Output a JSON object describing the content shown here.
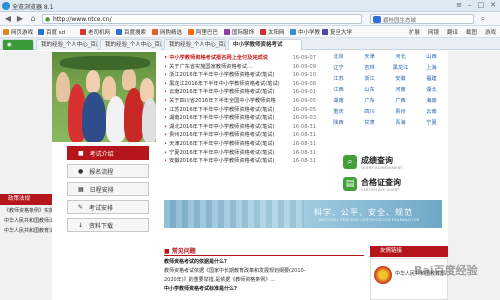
{
  "browser": {
    "title": "全览浏览器 8.1",
    "url": "http://www.ntce.cn/",
    "search_text": "碧桂园生态城",
    "favorites": [
      "网页游戏",
      "百度  sd",
      "老司机网",
      "百度搜索",
      "网购精选",
      "阿里巴巴",
      "国际服饰",
      "太阳网",
      "中小学教",
      "复旦大学"
    ],
    "tools": [
      "扩展",
      "网银",
      "翻译",
      "截图",
      "游戏"
    ],
    "tabs": [
      "我的经验_个人中心_百度经验",
      "我的经验_个人中心_百度经验",
      "我的经验_个人中心_百度经验",
      "中小学教师资格考试"
    ],
    "active_tab_index": 3
  },
  "news": {
    "items": [
      {
        "title": "中小学教师资格考试报名网上全付及完成说",
        "date": "16-09-07",
        "hot": true
      },
      {
        "title": "关于广东省实施国家教师资格考试…",
        "date": "16-09-09",
        "hot": false
      },
      {
        "title": "浙江2016年下半年中小学教师资格考试(笔试)",
        "date": "16-09-10",
        "hot": false
      },
      {
        "title": "黑龙江2016年下半年中小学教师资格考试(笔试)",
        "date": "16-09-08",
        "hot": false
      },
      {
        "title": "云南2016年下半年中小学教师资格考试(笔试)",
        "date": "16-09-01",
        "hot": false
      },
      {
        "title": "关于四川省2016年下半年全国中小学教师资格",
        "date": "16-09-05",
        "hot": false
      },
      {
        "title": "江苏2016年下半年中小学教师资格考试(笔试)",
        "date": "16-09-05",
        "hot": false
      },
      {
        "title": "湖南2016年下半年中小学教师资格考试(笔试)",
        "date": "16-09-03",
        "hot": false
      },
      {
        "title": "湖北2016年下半年中小学教师资格考试(笔试)",
        "date": "16-08-31",
        "hot": false
      },
      {
        "title": "贵州2016年下半年中小学教师资格考试(笔试)",
        "date": "16-08-31",
        "hot": false
      },
      {
        "title": "天津2016年下半年中小学教师资格考试(笔试)",
        "date": "16-08-31",
        "hot": false
      },
      {
        "title": "宁夏2016年下半年中小学教师资格考试(笔试)",
        "date": "16-08-31",
        "hot": false
      },
      {
        "title": "安徽2016年下半年中小学教师资格考试(笔试)",
        "date": "16-08-31",
        "hot": false
      }
    ]
  },
  "provinces": [
    "北京",
    "天津",
    "河北",
    "山西",
    "辽宁",
    "吉林",
    "黑龙江",
    "上海",
    "江苏",
    "浙江",
    "安徽",
    "福建",
    "江西",
    "山东",
    "河南",
    "湖北",
    "湖南",
    "广东",
    "广西",
    "海南",
    "重庆",
    "四川",
    "贵州",
    "云南",
    "陕西",
    "甘肃",
    "青海",
    "宁夏"
  ],
  "quick": {
    "score_label": "成绩查询",
    "score_sub": "QUERY ACHIEVEMENT",
    "cert_label": "合格证查询",
    "cert_sub": "CERTIFICATE QUERY"
  },
  "menu": {
    "items": [
      "考试介绍",
      "报名流程",
      "日程安排",
      "考试安排",
      "资料下载"
    ],
    "active_index": 0
  },
  "banner": {
    "text": "科学、公平、安全、规范",
    "sub": "NATIONAL TEACHER CERTIFICATION EXAMINATION"
  },
  "left_bar": {
    "header": "政策法规",
    "items": [
      "《教师资格条例》实施办法",
      "中华人民共和国教师法",
      "中华人民共和国教育法"
    ]
  },
  "bottom_left": {
    "header": "联系我们",
    "items": [
      "《教师资格条例》实施办法",
      "中华人民共和国教育法",
      "中华人民共和国职业教育法"
    ]
  },
  "faq": {
    "header": "常见问题",
    "items": [
      {
        "text": "教师资格考试的依据是什么?",
        "q": true
      },
      {
        "text": "教师资格考试依据《国家中长期教育改革和发展规划纲要(2010-",
        "q": false
      },
      {
        "text": "2020年)》的重要举措,是依据《教师资格条例》…",
        "q": false
      },
      {
        "text": "中小学教师资格考试标准是什么?",
        "q": true
      }
    ]
  },
  "friend": {
    "header": "友情链接",
    "text": "中华人民共和国教育部"
  },
  "watermark": "Bai百度经验"
}
